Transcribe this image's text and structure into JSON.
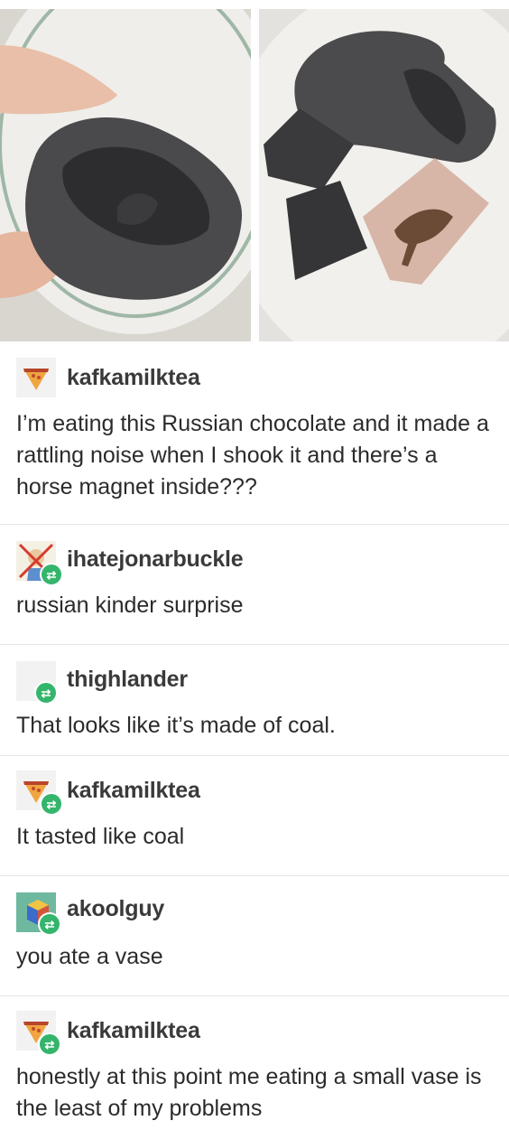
{
  "images": {
    "left_alt": "hand holding a broken dark chocolate egg",
    "right_alt": "broken chocolate egg pieces with a horse magnet in a bowl"
  },
  "posts": [
    {
      "username": "kafkamilktea",
      "text": "I’m eating this Russian chocolate and it made a rattling noise when I shook it and there’s a horse magnet inside???",
      "avatar_icon": "pizza-slice-icon",
      "reblog": false
    },
    {
      "username": "ihatejonarbuckle",
      "text": "russian kinder surprise",
      "avatar_icon": "crossed-out-cartoon-icon",
      "reblog": true
    },
    {
      "username": "thighlander",
      "text": "That looks like it’s made of coal.",
      "avatar_icon": "blank-avatar",
      "reblog": true
    },
    {
      "username": "kafkamilktea",
      "text": "It tasted like coal",
      "avatar_icon": "pizza-slice-icon",
      "reblog": true
    },
    {
      "username": "akoolguy",
      "text": "you ate a vase",
      "avatar_icon": "cube-icon",
      "reblog": true
    },
    {
      "username": "kafkamilktea",
      "text": "honestly at this point me eating a small vase is the least of my problems",
      "avatar_icon": "pizza-slice-icon",
      "reblog": true
    }
  ],
  "colors": {
    "reblog_badge": "#34b56b",
    "divider": "#e6e6e6"
  }
}
